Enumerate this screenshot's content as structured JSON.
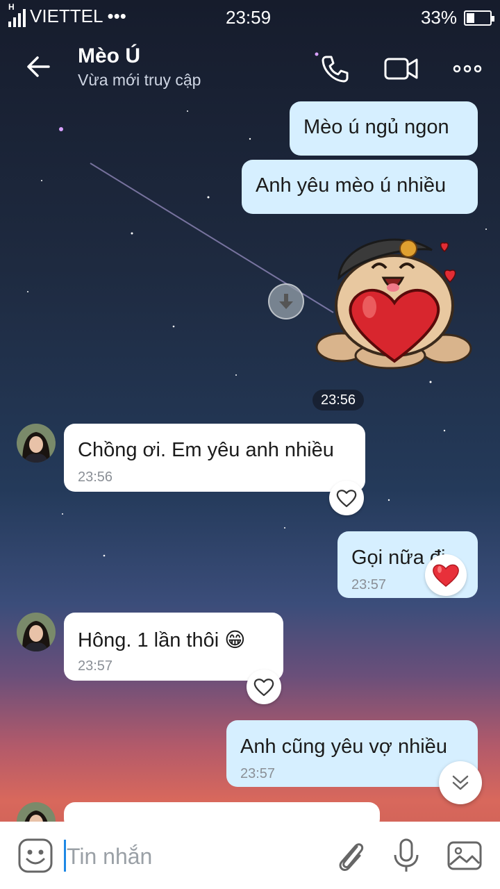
{
  "status_bar": {
    "network_type": "H",
    "carrier": "VIETTEL",
    "more": "•••",
    "time": "23:59",
    "battery_percent": "33%",
    "battery_level": 0.33
  },
  "header": {
    "contact_name": "Mèo Ú",
    "status": "Vừa mới truy cập"
  },
  "messages": [
    {
      "side": "mine",
      "text": "Mèo ú ngủ ngon"
    },
    {
      "side": "mine",
      "text": "Anh yêu mèo ú nhiều"
    },
    {
      "side": "mine",
      "type": "sticker",
      "sticker": "cat-hugging-heart"
    },
    {
      "side": "theirs",
      "text": "Chồng ơi. Em yêu anh nhiều",
      "time": "23:56",
      "reaction": "heart-outline"
    },
    {
      "side": "mine",
      "text": "Gọi nữa đi",
      "time": "23:57",
      "reaction": "heart-red"
    },
    {
      "side": "theirs",
      "text": "Hông. 1 lần thôi 😁",
      "time": "23:57",
      "reaction": "heart-outline"
    },
    {
      "side": "mine",
      "text": "Anh cũng yêu vợ nhiều",
      "time": "23:57"
    }
  ],
  "sticker_time": "23:56",
  "input": {
    "placeholder": "Tin nhắn"
  },
  "colors": {
    "mine_bubble": "#d6efff",
    "theirs_bubble": "#ffffff",
    "caret": "#1e88e5",
    "reaction_heart": "#e8303a"
  }
}
